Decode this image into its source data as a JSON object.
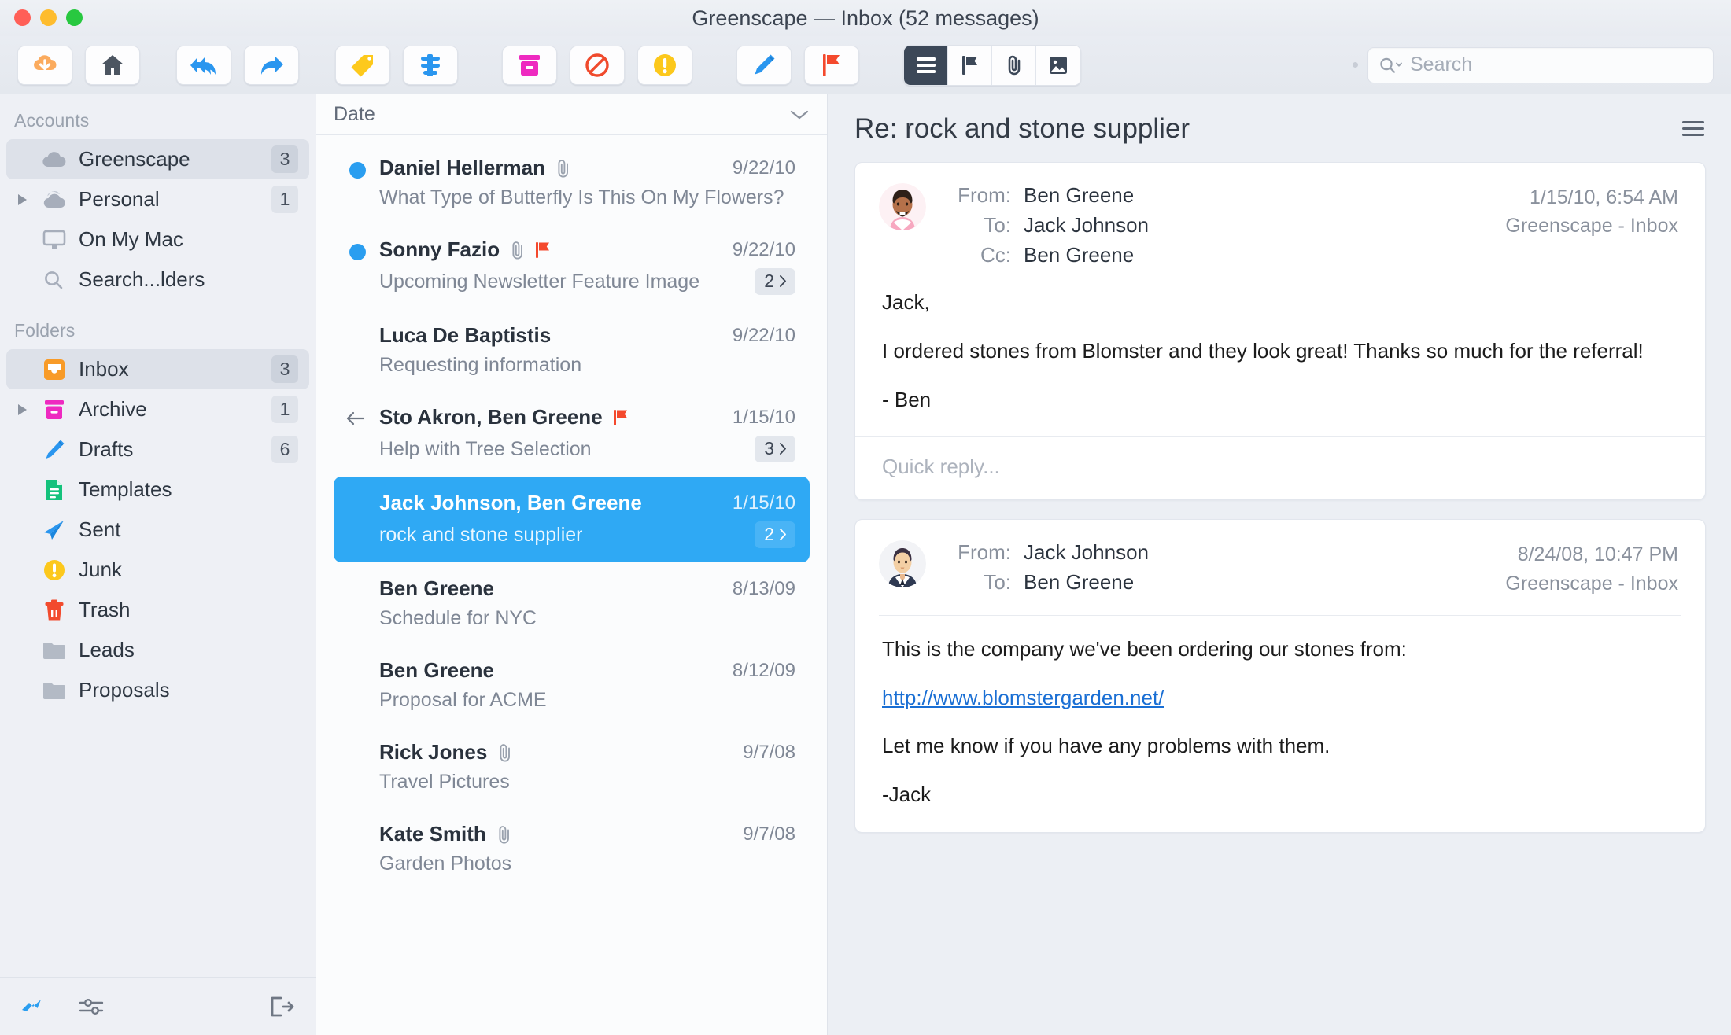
{
  "window": {
    "title": "Greenscape — Inbox (52 messages)"
  },
  "toolbar": {
    "buttons": [
      {
        "name": "get-mail-button",
        "icon": "cloud-download-icon"
      },
      {
        "name": "home-button",
        "icon": "home-icon"
      },
      {
        "name": "reply-all-button",
        "icon": "reply-all-icon"
      },
      {
        "name": "forward-button",
        "icon": "forward-arrow-icon"
      },
      {
        "name": "tag-button",
        "icon": "tag-icon"
      },
      {
        "name": "filter-button",
        "icon": "filter-icon"
      },
      {
        "name": "archive-button",
        "icon": "archive-box-icon"
      },
      {
        "name": "block-button",
        "icon": "block-icon"
      },
      {
        "name": "junk-button",
        "icon": "warning-circle-icon"
      },
      {
        "name": "compose-button",
        "icon": "pencil-icon"
      },
      {
        "name": "flag-button",
        "icon": "red-flag-icon"
      }
    ],
    "segmented": [
      {
        "name": "view-list-button",
        "icon": "list-lines-icon",
        "active": true
      },
      {
        "name": "view-flagged-button",
        "icon": "flag-outline-icon",
        "active": false
      },
      {
        "name": "view-attachments-button",
        "icon": "paperclip-icon",
        "active": false
      },
      {
        "name": "view-images-button",
        "icon": "image-icon",
        "active": false
      }
    ],
    "search": {
      "icon": "search-magnifier-icon",
      "placeholder": "Search",
      "value": ""
    }
  },
  "sidebar": {
    "accounts_header": "Accounts",
    "accounts": [
      {
        "label": "Greenscape",
        "badge": "3",
        "icon": "cloud-icon",
        "twisty": false,
        "selected": true
      },
      {
        "label": "Personal",
        "badge": "1",
        "icon": "cloud-stack-icon",
        "twisty": true,
        "selected": false
      },
      {
        "label": "On My Mac",
        "badge": "",
        "icon": "monitor-icon",
        "twisty": false,
        "selected": false
      },
      {
        "label": "Search...lders",
        "badge": "",
        "icon": "search-magnifier-icon",
        "twisty": false,
        "selected": false
      }
    ],
    "folders_header": "Folders",
    "folders": [
      {
        "label": "Inbox",
        "badge": "3",
        "icon": "inbox-icon",
        "twisty": false,
        "selected": true
      },
      {
        "label": "Archive",
        "badge": "1",
        "icon": "archive-box-icon",
        "twisty": true,
        "selected": false
      },
      {
        "label": "Drafts",
        "badge": "6",
        "icon": "pencil-icon",
        "twisty": false,
        "selected": false
      },
      {
        "label": "Templates",
        "badge": "",
        "icon": "document-icon",
        "twisty": false,
        "selected": false
      },
      {
        "label": "Sent",
        "badge": "",
        "icon": "paper-plane-icon",
        "twisty": false,
        "selected": false
      },
      {
        "label": "Junk",
        "badge": "",
        "icon": "warning-circle-icon",
        "twisty": false,
        "selected": false
      },
      {
        "label": "Trash",
        "badge": "",
        "icon": "trash-icon",
        "twisty": false,
        "selected": false
      },
      {
        "label": "Leads",
        "badge": "",
        "icon": "folder-icon",
        "twisty": false,
        "selected": false
      },
      {
        "label": "Proposals",
        "badge": "",
        "icon": "folder-icon",
        "twisty": false,
        "selected": false
      }
    ],
    "footer": [
      {
        "name": "activity-icon"
      },
      {
        "name": "sliders-settings-icon"
      },
      {
        "name": "logout-icon"
      }
    ]
  },
  "message_list": {
    "sort_label": "Date",
    "sort_chevron": "chevron-down-icon",
    "messages": [
      {
        "sender": "Daniel Hellerman",
        "subject": "What Type of Butterfly Is This On My Flowers?",
        "date": "9/22/10",
        "unread": true,
        "attachment": true,
        "flagged": false,
        "thread_count": "",
        "selected": false,
        "replied": false
      },
      {
        "sender": "Sonny Fazio",
        "subject": "Upcoming Newsletter Feature Image",
        "date": "9/22/10",
        "unread": true,
        "attachment": true,
        "flagged": true,
        "thread_count": "2",
        "selected": false,
        "replied": false
      },
      {
        "sender": "Luca De Baptistis",
        "subject": "Requesting information",
        "date": "9/22/10",
        "unread": false,
        "attachment": false,
        "flagged": false,
        "thread_count": "",
        "selected": false,
        "replied": false
      },
      {
        "sender": "Sto Akron, Ben Greene",
        "subject": "Help with Tree Selection",
        "date": "1/15/10",
        "unread": false,
        "attachment": false,
        "flagged": true,
        "thread_count": "3",
        "selected": false,
        "replied": true
      },
      {
        "sender": "Jack Johnson, Ben Greene",
        "subject": "rock and stone supplier",
        "date": "1/15/10",
        "unread": false,
        "attachment": false,
        "flagged": false,
        "thread_count": "2",
        "selected": true,
        "replied": false
      },
      {
        "sender": "Ben Greene",
        "subject": "Schedule for NYC",
        "date": "8/13/09",
        "unread": false,
        "attachment": false,
        "flagged": false,
        "thread_count": "",
        "selected": false,
        "replied": false
      },
      {
        "sender": "Ben Greene",
        "subject": "Proposal for ACME",
        "date": "8/12/09",
        "unread": false,
        "attachment": false,
        "flagged": false,
        "thread_count": "",
        "selected": false,
        "replied": false
      },
      {
        "sender": "Rick Jones",
        "subject": "Travel Pictures",
        "date": "9/7/08",
        "unread": false,
        "attachment": true,
        "flagged": false,
        "thread_count": "",
        "selected": false,
        "replied": false
      },
      {
        "sender": "Kate Smith",
        "subject": "Garden Photos",
        "date": "9/7/08",
        "unread": false,
        "attachment": true,
        "flagged": false,
        "thread_count": "",
        "selected": false,
        "replied": false
      }
    ]
  },
  "detail": {
    "title": "Re: rock and stone supplier",
    "menu_icon": "hamburger-menu-icon",
    "messages": [
      {
        "avatar": "avatar-ben-greene",
        "from_label": "From:",
        "from_value": "Ben Greene",
        "to_label": "To:",
        "to_value": "Jack Johnson",
        "cc_label": "Cc:",
        "cc_value": "Ben Greene",
        "timestamp": "1/15/10, 6:54 AM",
        "mailbox": "Greenscape - Inbox",
        "paragraphs": [
          "Jack,",
          "I ordered stones from Blomster and they look great!  Thanks so much for the referral!",
          "- Ben"
        ],
        "link": "",
        "quick_reply_placeholder": "Quick reply..."
      },
      {
        "avatar": "avatar-jack-johnson",
        "from_label": "From:",
        "from_value": "Jack Johnson",
        "to_label": "To:",
        "to_value": "Ben Greene",
        "cc_label": "",
        "cc_value": "",
        "timestamp": "8/24/08, 10:47 PM",
        "mailbox": "Greenscape - Inbox",
        "paragraphs": [
          "This is the company we've been ordering our stones from:",
          "",
          "Let me know if you have any problems with them.",
          "-Jack"
        ],
        "link": "http://www.blomstergarden.net/",
        "quick_reply_placeholder": ""
      }
    ]
  },
  "colors": {
    "accent_blue": "#2fa9f4",
    "flag_red": "#f4492d",
    "unread_dot": "#2a9ef0",
    "sidebar_bg": "#eef0f5",
    "link": "#1a6fd4"
  }
}
